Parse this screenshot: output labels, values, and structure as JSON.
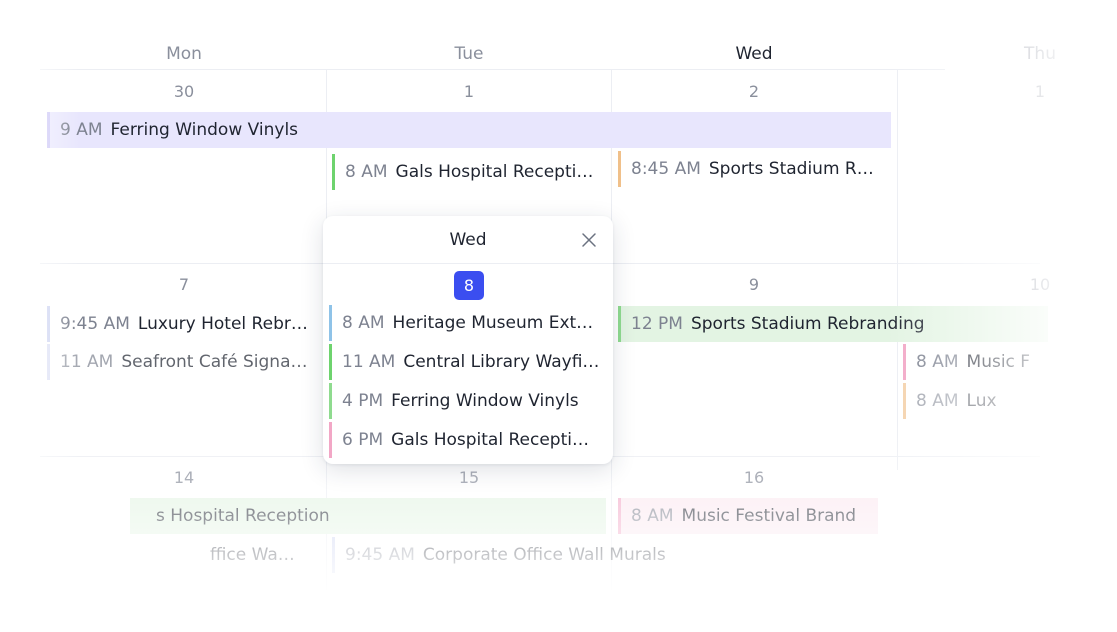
{
  "days": [
    "Mon",
    "Tue",
    "Wed",
    "Thu"
  ],
  "week1": {
    "dates": [
      "30",
      "1",
      "2",
      "1"
    ]
  },
  "week2": {
    "dates": [
      "7",
      "9",
      "10"
    ]
  },
  "week3": {
    "dates": [
      "14",
      "15",
      "16"
    ]
  },
  "events": {
    "ferring_bar": {
      "time": "9 AM",
      "name": "Ferring Window Vinyls",
      "color": "#e8e6fd"
    },
    "gals_tue": {
      "time": "8 AM",
      "name": "Gals Hospital Recepti…",
      "color": "#6ed36e"
    },
    "sports_wed": {
      "time": "8:45 AM",
      "name": "Sports Stadium R…",
      "color": "#f0c08a"
    },
    "luxury_mon": {
      "time": "9:45 AM",
      "name": "Luxury Hotel Rebr…"
    },
    "seafront_mon": {
      "time": "11 AM",
      "name": "Seafront Café Signa…"
    },
    "sports_bar": {
      "time": "12 PM",
      "name": "Sports Stadium Rebranding",
      "color": "#e3f4e3"
    },
    "music_thu": {
      "time": "8 AM",
      "name": "Music F"
    },
    "lux_thu": {
      "time": "8 AM",
      "name": "Lux"
    },
    "hospital_bar": {
      "name": "s Hospital Reception",
      "color": "#e3f4e3"
    },
    "office_mon": {
      "name": "ffice Wa…"
    },
    "corporate_tue": {
      "time": "9:45 AM",
      "name": "Corporate Office Wall Murals"
    },
    "music_wed": {
      "time": "8 AM",
      "name": "Music Festival Brand",
      "color": "#fbe8f0"
    }
  },
  "popup": {
    "title": "Wed",
    "date": "8",
    "accent": "#3b4ef0",
    "events": [
      {
        "time": "8 AM",
        "name": "Heritage Museum Ext…",
        "color": "#8fc3e8"
      },
      {
        "time": "11 AM",
        "name": "Central Library Wayfi…",
        "color": "#6ed36e"
      },
      {
        "time": "4 PM",
        "name": "Ferring Window Vinyls",
        "color": "#8fdb8f"
      },
      {
        "time": "6 PM",
        "name": "Gals Hospital Recepti…",
        "color": "#f2a7c6"
      }
    ]
  }
}
